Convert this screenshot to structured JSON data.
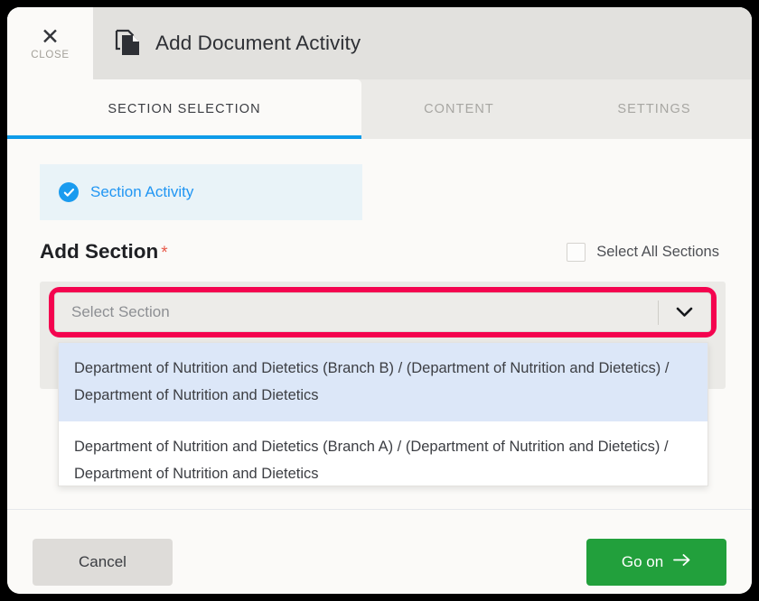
{
  "header": {
    "close_label": "CLOSE",
    "close_icon": "close-x-icon",
    "doc_icon": "copy-documents-icon",
    "title": "Add Document Activity"
  },
  "tabs": [
    {
      "label": "SECTION SELECTION",
      "active": true
    },
    {
      "label": "CONTENT",
      "active": false
    },
    {
      "label": "SETTINGS",
      "active": false
    }
  ],
  "main": {
    "activity_card": {
      "label": "Section Activity",
      "icon": "check-circle-icon",
      "selected": true
    },
    "section_title": "Add Section",
    "required_marker": "*",
    "select_all": {
      "label": "Select All Sections",
      "checked": false
    },
    "section_select": {
      "placeholder": "Select Section",
      "value": "",
      "arrow_icon": "chevron-down-icon",
      "expanded": true
    },
    "dropdown_options": [
      {
        "label": "Department of Nutrition and Dietetics (Branch B) / (Department of Nutrition and Dietetics) / Department of Nutrition and Dietetics",
        "highlighted": true
      },
      {
        "label": "Department of Nutrition and Dietetics (Branch A) / (Department of Nutrition and Dietetics) / Department of Nutrition and Dietetics",
        "highlighted": false
      }
    ]
  },
  "footer": {
    "cancel_label": "Cancel",
    "goon_label": "Go on",
    "goon_icon": "arrow-right-icon"
  },
  "colors": {
    "accent_blue": "#0E9BE9",
    "highlight_pink": "#F4044F",
    "primary_green": "#22A03C",
    "required_red": "#e8594a",
    "option_highlight": "#DCE7F8"
  }
}
